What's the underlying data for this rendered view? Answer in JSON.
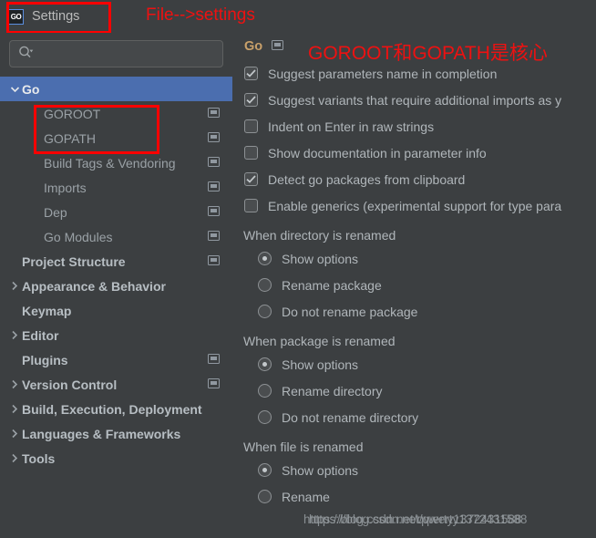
{
  "window": {
    "title": "Settings",
    "logo_text": "GO",
    "logo_icon": "goland-logo-icon"
  },
  "annotations": [
    {
      "id": "file-settings",
      "text": "File-->settings",
      "color": "#ee1111"
    },
    {
      "id": "goroot-gopath",
      "text": "GOROOT和GOPATH是核心",
      "color": "#ee1111"
    }
  ],
  "annotation_boxes": [
    {
      "id": "settings-title-box",
      "color": "#ff0000"
    },
    {
      "id": "goroot-gopath-box",
      "color": "#ff0000"
    }
  ],
  "search": {
    "value": "",
    "placeholder": "",
    "icon": "search-icon",
    "dropdown_icon": "chevron-down-icon"
  },
  "sidebar": {
    "items": [
      {
        "label": "Go",
        "level": 0,
        "arrow": "chevron-down-icon",
        "selected": true,
        "bold": true,
        "setting_icon": false
      },
      {
        "label": "GOROOT",
        "level": 1,
        "arrow": "",
        "selected": false,
        "bold": false,
        "setting_icon": true
      },
      {
        "label": "GOPATH",
        "level": 1,
        "arrow": "",
        "selected": false,
        "bold": false,
        "setting_icon": true
      },
      {
        "label": "Build Tags & Vendoring",
        "level": 1,
        "arrow": "",
        "selected": false,
        "bold": false,
        "setting_icon": true
      },
      {
        "label": "Imports",
        "level": 1,
        "arrow": "",
        "selected": false,
        "bold": false,
        "setting_icon": true
      },
      {
        "label": "Dep",
        "level": 1,
        "arrow": "",
        "selected": false,
        "bold": false,
        "setting_icon": true
      },
      {
        "label": "Go Modules",
        "level": 1,
        "arrow": "",
        "selected": false,
        "bold": false,
        "setting_icon": true
      },
      {
        "label": "Project Structure",
        "level": 0,
        "arrow": "",
        "selected": false,
        "bold": true,
        "setting_icon": true
      },
      {
        "label": "Appearance & Behavior",
        "level": 0,
        "arrow": "chevron-right-icon",
        "selected": false,
        "bold": true,
        "setting_icon": false
      },
      {
        "label": "Keymap",
        "level": 0,
        "arrow": "",
        "selected": false,
        "bold": true,
        "setting_icon": false
      },
      {
        "label": "Editor",
        "level": 0,
        "arrow": "chevron-right-icon",
        "selected": false,
        "bold": true,
        "setting_icon": false
      },
      {
        "label": "Plugins",
        "level": 0,
        "arrow": "",
        "selected": false,
        "bold": true,
        "setting_icon": true
      },
      {
        "label": "Version Control",
        "level": 0,
        "arrow": "chevron-right-icon",
        "selected": false,
        "bold": true,
        "setting_icon": true
      },
      {
        "label": "Build, Execution, Deployment",
        "level": 0,
        "arrow": "chevron-right-icon",
        "selected": false,
        "bold": true,
        "setting_icon": false
      },
      {
        "label": "Languages & Frameworks",
        "level": 0,
        "arrow": "chevron-right-icon",
        "selected": false,
        "bold": true,
        "setting_icon": false
      },
      {
        "label": "Tools",
        "level": 0,
        "arrow": "chevron-right-icon",
        "selected": false,
        "bold": true,
        "setting_icon": false
      }
    ]
  },
  "main": {
    "title": "Go",
    "title_setting_icon": "project-setting-icon",
    "checkboxes": [
      {
        "label": "Suggest parameters name in completion",
        "checked": true
      },
      {
        "label": "Suggest variants that require additional imports as y",
        "checked": true
      },
      {
        "label": "Indent on Enter in raw strings",
        "checked": false
      },
      {
        "label": "Show documentation in parameter info",
        "checked": false
      },
      {
        "label": "Detect go packages from clipboard",
        "checked": true
      },
      {
        "label": "Enable generics (experimental support for type para",
        "checked": false
      }
    ],
    "radio_groups": [
      {
        "title": "When directory is renamed",
        "options": [
          {
            "label": "Show options",
            "selected": true
          },
          {
            "label": "Rename package",
            "selected": false
          },
          {
            "label": "Do not rename package",
            "selected": false
          }
        ]
      },
      {
        "title": "When package is renamed",
        "options": [
          {
            "label": "Show options",
            "selected": true
          },
          {
            "label": "Rename directory",
            "selected": false
          },
          {
            "label": "Do not rename directory",
            "selected": false
          }
        ]
      },
      {
        "title": "When file is renamed",
        "options": [
          {
            "label": "Show options",
            "selected": true
          },
          {
            "label": "Rename",
            "selected": false
          }
        ]
      }
    ]
  },
  "watermark": {
    "line1": "https://blog.csdn.net/qwerty1372431588",
    "line2": "https://blog.csdn.net/qwerty1372431588"
  },
  "colors": {
    "background": "#3c3f41",
    "selection": "#4b6eaf",
    "accent_title": "#c8a06a",
    "annotation_red": "#ff0000",
    "text": "#b0b6ba"
  }
}
